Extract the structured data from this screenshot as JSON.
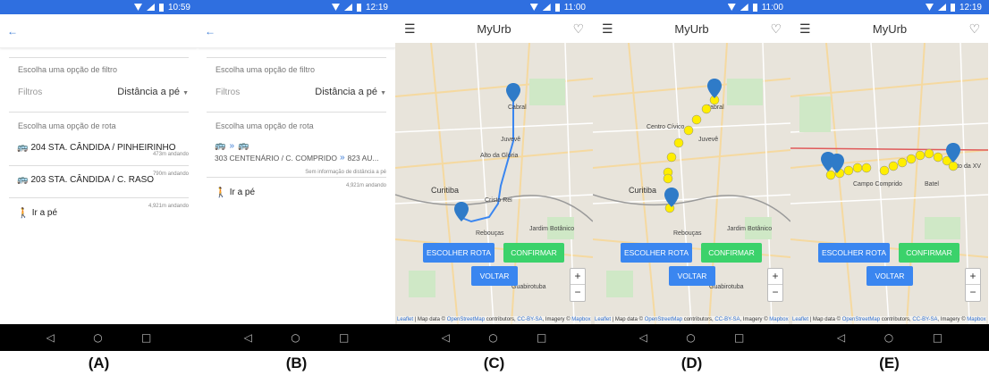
{
  "panels": {
    "a": {
      "time": "10:59",
      "filter_section": "Escolha uma opção de filtro",
      "filter_label": "Filtros",
      "filter_value": "Distância a pé",
      "route_section": "Escolha uma opção de rota",
      "routes": [
        {
          "label": "204 STA. CÂNDIDA / PINHEIRINHO",
          "dist": "473m andando"
        },
        {
          "label": "203 STA. CÂNDIDA / C. RASO",
          "dist": "790m andando"
        }
      ],
      "walk_label": "Ir a pé",
      "walk_dist": "4,921m andando"
    },
    "b": {
      "time": "12:19",
      "filter_section": "Escolha uma opção de filtro",
      "filter_label": "Filtros",
      "filter_value": "Distância a pé",
      "route_section": "Escolha uma opção de rota",
      "route_label_1": "303 CENTENÁRIO / C. COMPRIDO",
      "route_label_2": "823 AU...",
      "route_sub": "Sem informação de distância a pé",
      "walk_label": "Ir a pé",
      "walk_dist": "4,921m andando"
    },
    "c": {
      "time": "11:00",
      "title": "MyUrb"
    },
    "d": {
      "time": "11:00",
      "title": "MyUrb"
    },
    "e": {
      "time": "12:19",
      "title": "MyUrb"
    }
  },
  "map_labels": {
    "cabral": "Cabral",
    "juveve": "Juvevê",
    "alto_gloria": "Alto da Glória",
    "curitiba": "Curitiba",
    "rebouças": "Rebouças",
    "jardim_botanico": "Jardim Botânico",
    "guabirotuba": "Guabirotuba",
    "centro_civico": "Centro Cívico",
    "cristo_rei": "Cristo Rei",
    "campo_comprido": "Campo Comprido",
    "batel": "Batel",
    "alto_xv": "Alto da XV"
  },
  "buttons": {
    "escolher": "ESCOLHER ROTA",
    "confirmar": "CONFIRMAR",
    "voltar": "VOLTAR",
    "zoom_in": "+",
    "zoom_out": "−"
  },
  "attribution": {
    "leaflet": "Leaflet",
    "text1": " | Map data © ",
    "osm": "OpenStreetMap",
    "text2": " contributors, ",
    "cc": "CC-BY-SA",
    "text3": ", Imagery © ",
    "mapbox": "Mapbox"
  },
  "captions": [
    "(A)",
    "(B)",
    "(C)",
    "(D)",
    "(E)"
  ],
  "colors": {
    "accent": "#3a7bd5",
    "confirm": "#3bd26b",
    "route": "#3a86f0",
    "marker": "#2f7bc8",
    "point": "#ffee00"
  }
}
